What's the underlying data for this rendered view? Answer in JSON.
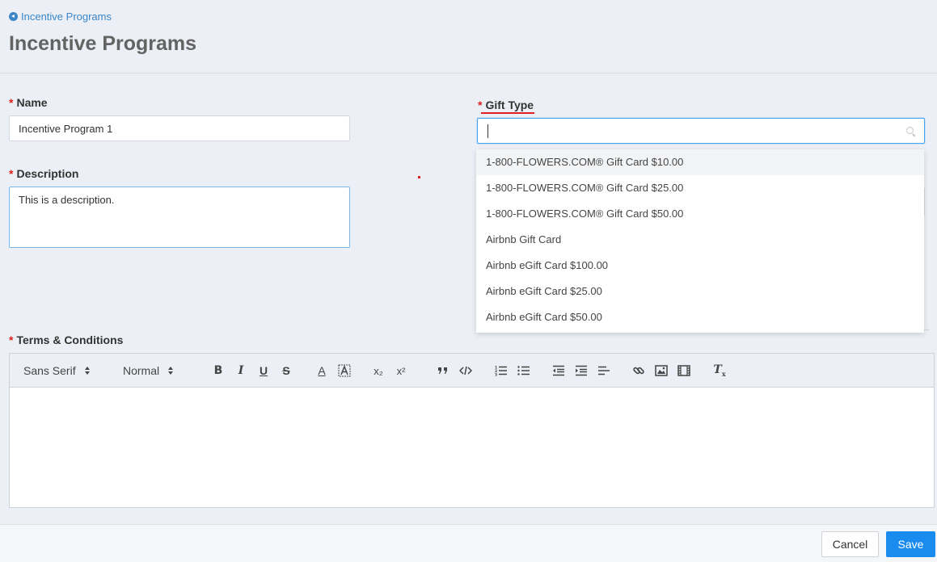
{
  "header": {
    "back_label": "Incentive Programs",
    "title": "Incentive Programs"
  },
  "form": {
    "name_label": "Name",
    "name_value": "Incentive Program 1",
    "description_label": "Description",
    "description_value": "This is a description.",
    "gift_type_label": "Gift Type",
    "gift_type_value": "",
    "terms_label": "Terms & Conditions",
    "required_marker": "*"
  },
  "gift_options": [
    "1-800-FLOWERS.COM® Gift Card $10.00",
    "1-800-FLOWERS.COM® Gift Card $25.00",
    "1-800-FLOWERS.COM® Gift Card $50.00",
    "Airbnb Gift Card",
    "Airbnb eGift Card $100.00",
    "Airbnb eGift Card $25.00",
    "Airbnb eGift Card $50.00"
  ],
  "toolbar": {
    "font": "Sans Serif",
    "size": "Normal",
    "bold": "B",
    "italic": "I",
    "underline": "U",
    "strike": "S",
    "color": "A",
    "subscript": "x₂",
    "superscript": "x²",
    "clean": "Tx"
  },
  "footer": {
    "cancel_label": "Cancel",
    "save_label": "Save"
  },
  "colors": {
    "accent": "#1a8cf0",
    "required": "#e02020",
    "link": "#3a86c8"
  }
}
